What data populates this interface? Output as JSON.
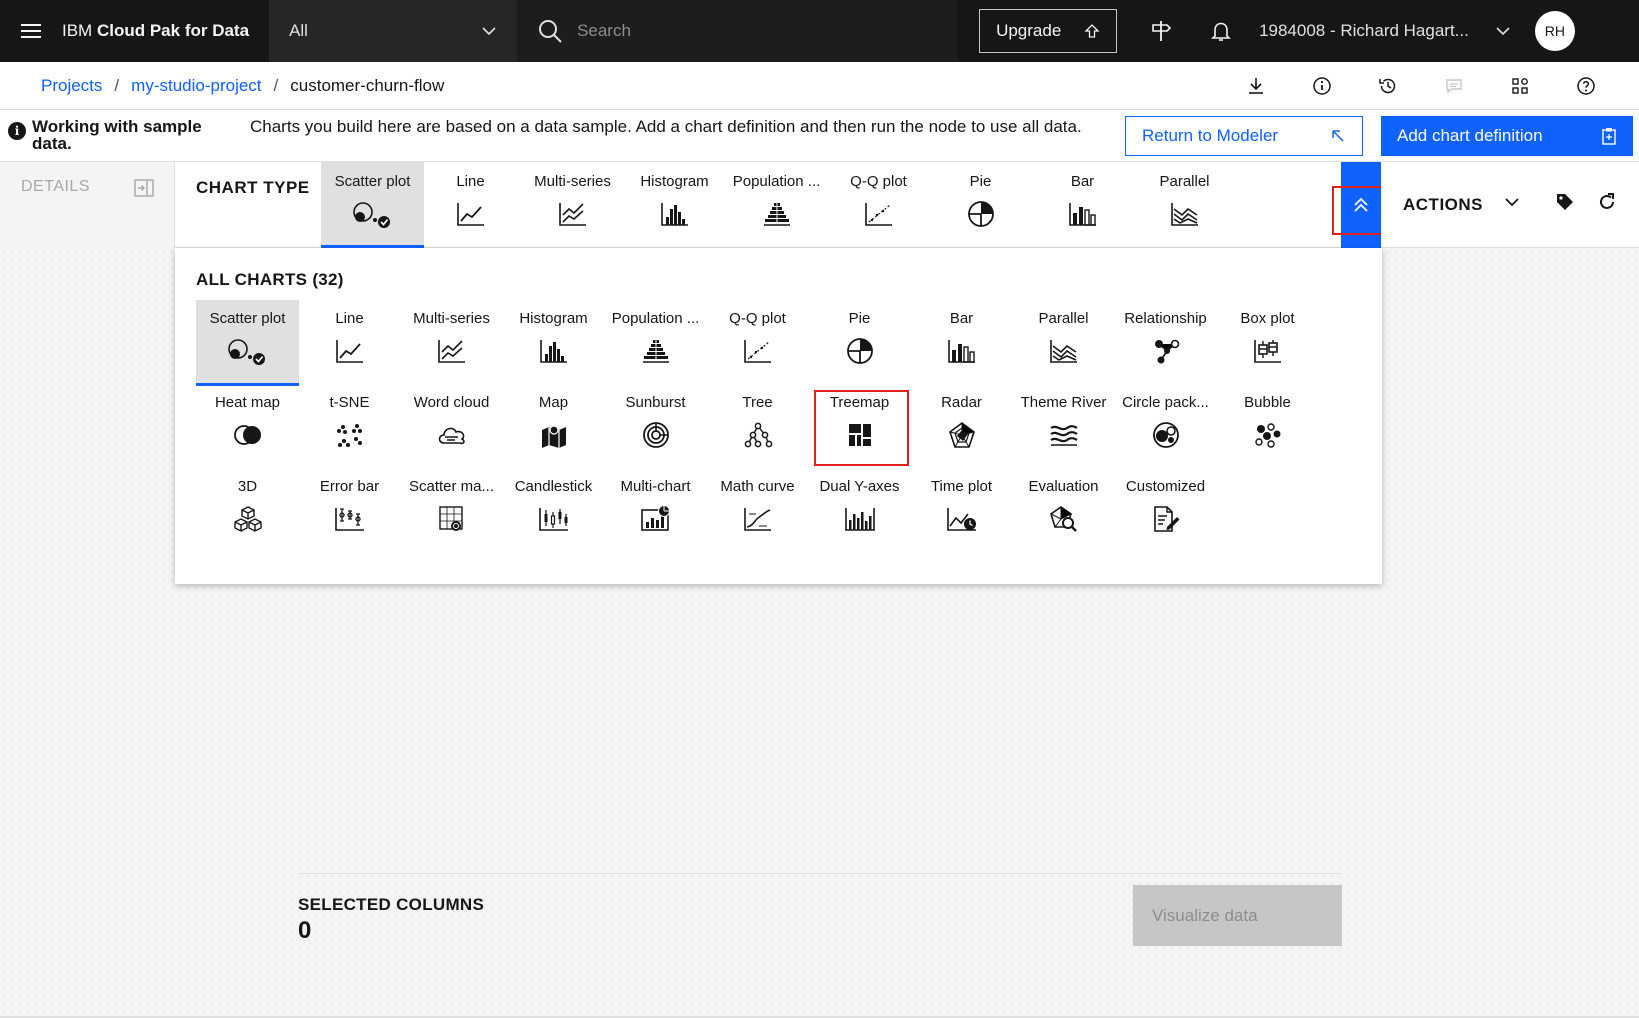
{
  "header": {
    "brand_prefix": "IBM",
    "brand_bold": "Cloud Pak for Data",
    "scope": "All",
    "search_placeholder": "Search",
    "upgrade_label": "Upgrade",
    "account": "1984008 - Richard Hagart...",
    "avatar_initials": "RH"
  },
  "breadcrumb": {
    "items": [
      "Projects",
      "my-studio-project",
      "customer-churn-flow"
    ],
    "separator": "/"
  },
  "notice": {
    "title": "Working with sample data.",
    "message": "Charts you build here are based on a data sample. Add a chart definition and then run the node to use all data.",
    "return_label": "Return to Modeler",
    "add_label": "Add chart definition"
  },
  "chart_type_bar": {
    "details_label": "DETAILS",
    "label": "CHART TYPE",
    "tabs": [
      "Scatter plot",
      "Line",
      "Multi-series",
      "Histogram",
      "Population ...",
      "Q-Q plot",
      "Pie",
      "Bar",
      "Parallel"
    ],
    "selected": "Scatter plot",
    "actions_label": "ACTIONS"
  },
  "all_charts": {
    "title": "ALL CHARTS (32)",
    "rows": [
      [
        "Scatter plot",
        "Line",
        "Multi-series",
        "Histogram",
        "Population ...",
        "Q-Q plot",
        "Pie",
        "Bar",
        "Parallel",
        "Relationship",
        "Box plot"
      ],
      [
        "Heat map",
        "t-SNE",
        "Word cloud",
        "Map",
        "Sunburst",
        "Tree",
        "Treemap",
        "Radar",
        "Theme River",
        "Circle pack...",
        "Bubble"
      ],
      [
        "3D",
        "Error bar",
        "Scatter ma...",
        "Candlestick",
        "Multi-chart",
        "Math curve",
        "Dual Y-axes",
        "Time plot",
        "Evaluation",
        "Customized"
      ]
    ],
    "highlighted": "Treemap"
  },
  "selected_columns": {
    "label": "SELECTED COLUMNS",
    "count": "0",
    "visualize_label": "Visualize data"
  },
  "colors": {
    "accent": "#0f62fe",
    "highlight": "#e01f1f",
    "header_bg": "#161616"
  }
}
